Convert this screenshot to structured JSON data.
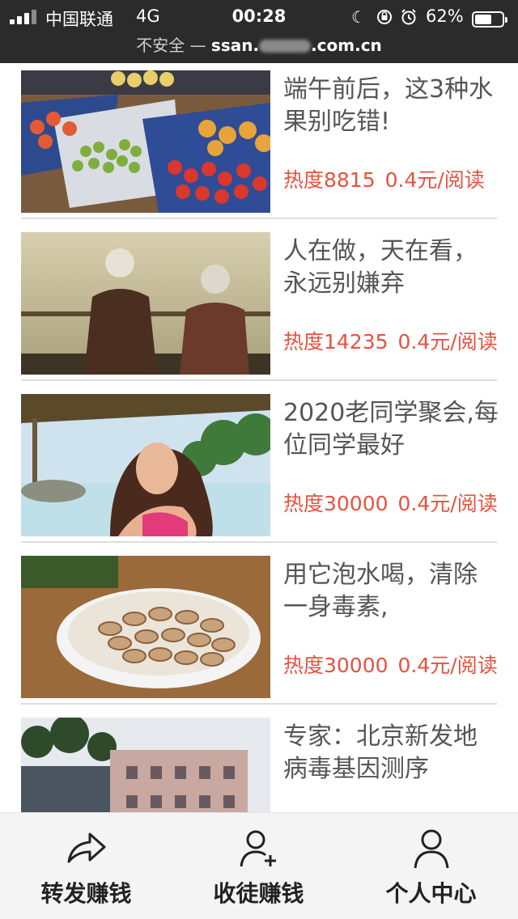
{
  "status_bar": {
    "carrier": "中国联通",
    "network": "4G",
    "time": "00:28",
    "battery_percent": "62%",
    "battery_level": 0.62,
    "icons": [
      "moon-icon",
      "orientation-lock-icon",
      "alarm-icon"
    ]
  },
  "url_bar": {
    "security": "不安全 —",
    "domain_start": "ssan.",
    "domain_end": ".com.cn"
  },
  "articles": [
    {
      "title": "端午前后，这3种水果别吃错!",
      "heat": "热度8815",
      "price": "0.4元/阅读",
      "image": "fruit-market-crates"
    },
    {
      "title": "人在做，天在看，永远别嫌弃",
      "heat": "热度14235",
      "price": "0.4元/阅读",
      "image": "elderly-couple-lake"
    },
    {
      "title": "2020老同学聚会,每位同学最好",
      "heat": "热度30000",
      "price": "0.4元/阅读",
      "image": "woman-blowing-kiss-beach"
    },
    {
      "title": "用它泡水喝，清除一身毒素,",
      "heat": "热度30000",
      "price": "0.4元/阅读",
      "image": "sliced-herb-root-plate"
    },
    {
      "title": "专家：北京新发地病毒基因测序",
      "heat": "",
      "price": "",
      "image": "market-buildings"
    }
  ],
  "tab_bar": {
    "tabs": [
      {
        "label": "转发赚钱",
        "icon": "share-forward-icon"
      },
      {
        "label": "收徒赚钱",
        "icon": "add-user-icon"
      },
      {
        "label": "个人中心",
        "icon": "user-profile-icon"
      }
    ]
  },
  "colors": {
    "status_bar_bg": "#2b2b2b",
    "title_text": "#555555",
    "accent_red": "#e8513e",
    "tab_bar_bg": "#f4f4f4"
  }
}
